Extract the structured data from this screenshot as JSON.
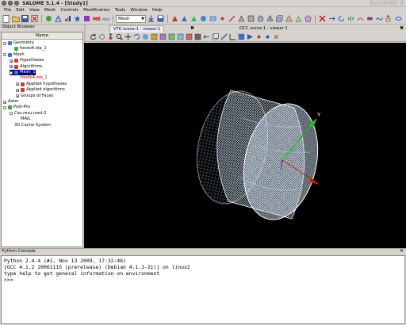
{
  "window": {
    "title": "SALOME 5.1.4 - [Study1]",
    "logo_text": "SALOME 5"
  },
  "menubar": [
    "File",
    "Edit",
    "View",
    "Mesh",
    "Controls",
    "Modification",
    "Tools",
    "Window",
    "Help"
  ],
  "toolbar": {
    "module_selected": "Mesh"
  },
  "object_browser": {
    "title": "Object Browser",
    "column_header": "Name",
    "items": [
      {
        "label": "Geometry",
        "level": 0,
        "expander": "-",
        "icon_color": "#3b7ad0"
      },
      {
        "label": "fondo4.stp_1",
        "level": 1,
        "expander": "",
        "icon_color": "#4aa04a"
      },
      {
        "label": "Mesh",
        "level": 0,
        "expander": "-",
        "icon_color": "#3b7ad0"
      },
      {
        "label": "Hypotheses",
        "level": 1,
        "expander": "+",
        "icon_color": "#c04040"
      },
      {
        "label": "Algorithms",
        "level": 1,
        "expander": "+",
        "icon_color": "#c04040"
      },
      {
        "label": "Mesh_1",
        "level": 1,
        "expander": "-",
        "icon_color": "#3b7ad0",
        "selected": true
      },
      {
        "label": "fondo4.stp_1",
        "level": 2,
        "expander": "",
        "icon_color": "",
        "red": true
      },
      {
        "label": "Applied hypotheses",
        "level": 2,
        "expander": "+",
        "icon_color": "#c04040"
      },
      {
        "label": "Applied algorithms",
        "level": 2,
        "expander": "+",
        "icon_color": "#c04040"
      },
      {
        "label": "Groups of Faces",
        "level": 2,
        "expander": "+",
        "icon_color": ""
      },
      {
        "label": "Aster",
        "level": 0,
        "expander": "+",
        "icon_color": ""
      },
      {
        "label": "Post-Pro",
        "level": 0,
        "expander": "-",
        "icon_color": "#4a9a4a"
      },
      {
        "label": "Cas.resu.med:2",
        "level": 1,
        "expander": "-",
        "icon_color": ""
      },
      {
        "label": "MAIL",
        "level": 2,
        "expander": "",
        "icon_color": ""
      },
      {
        "label": "3D Cache System",
        "level": 1,
        "expander": "",
        "icon_color": ""
      }
    ]
  },
  "viewer_tabs": [
    {
      "label": "VTK scene:1 - viewer:1",
      "active": true
    },
    {
      "label": "OCC scene:1 - viewer:1",
      "active": false
    }
  ],
  "axes": {
    "y_label": "Y",
    "x_color": "#dd1111",
    "y_color": "#22bb22",
    "z_color": "#2222dd"
  },
  "console": {
    "title": "Python Console",
    "lines": [
      "Python 2.4.4 (#1, Nov 13 2009, 17:32:46)",
      "[GCC 4.1.2 20061115 (prerelease) (Debian 4.1.1-21)] on linux2",
      "type help to get general information on environment",
      ">>>"
    ]
  },
  "colors": {
    "selection": "#00007f",
    "mesh": "#bfdcf2",
    "viewer_bg": "#000000"
  }
}
